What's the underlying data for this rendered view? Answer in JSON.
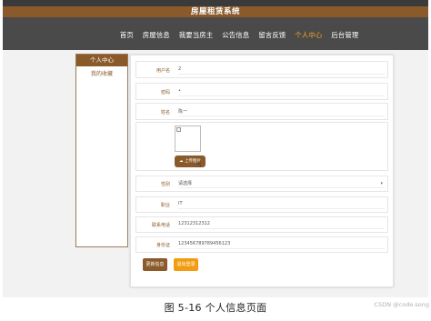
{
  "app": {
    "title": "房屋租赁系统"
  },
  "nav": [
    "首页",
    "房屋信息",
    "我要当房主",
    "公告信息",
    "留言反馈",
    "个人中心",
    "后台管理"
  ],
  "nav_active_index": 5,
  "sidebar": {
    "header": "个人中心",
    "items": [
      "我的收藏"
    ]
  },
  "form": {
    "username": {
      "label": "用户名",
      "value": "2"
    },
    "password": {
      "label": "密码",
      "value": "•"
    },
    "name": {
      "label": "姓名",
      "value": "陈一"
    },
    "upload_label": "上传图片",
    "gender": {
      "label": "性别",
      "value": "请选择"
    },
    "occupation": {
      "label": "职业",
      "value": "IT"
    },
    "phone": {
      "label": "联系电话",
      "value": "12312312312"
    },
    "id_card": {
      "label": "身份证",
      "value": "123456789789456123"
    }
  },
  "buttons": {
    "update": "更新信息",
    "logout": "退出登录"
  },
  "colors": {
    "brand": "#8a5a2b",
    "accent": "#f4a62a",
    "nav_bg": "#4a4a4a",
    "logout": "#f39c12"
  },
  "icons": {
    "upload": "cloud-upload-icon",
    "select": "chevron-down-icon",
    "cursor": "hand-pointer-icon"
  },
  "caption": "图 5-16 个人信息页面",
  "watermark": "CSDN @code.song"
}
